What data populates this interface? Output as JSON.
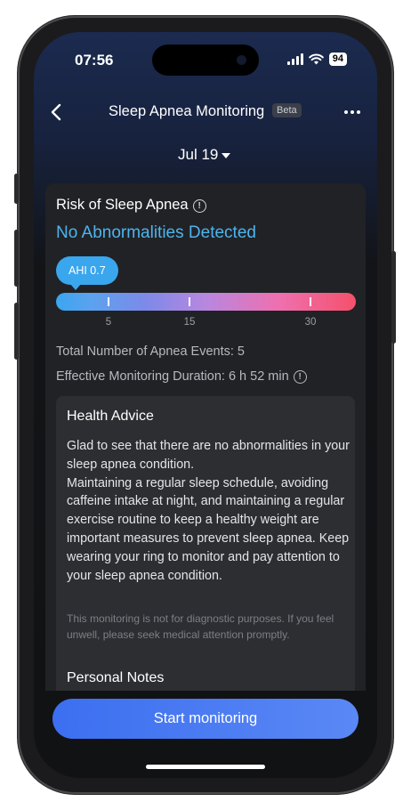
{
  "status_bar": {
    "time": "07:56",
    "battery": "94"
  },
  "nav": {
    "title": "Sleep Apnea Monitoring",
    "badge": "Beta"
  },
  "date_selector": {
    "label": "Jul 19"
  },
  "risk": {
    "title": "Risk of Sleep Apnea",
    "result": "No Abnormalities Detected",
    "ahi_label": "AHI 0.7",
    "ahi_value": 0.7,
    "scale_ticks": [
      "5",
      "15",
      "30"
    ]
  },
  "stats": {
    "events": "Total Number of Apnea Events: 5",
    "duration": "Effective Monitoring Duration: 6 h 52 min"
  },
  "advice": {
    "title": "Health Advice",
    "body": "Glad to see that there are no abnormalities in your sleep apnea condition.\nMaintaining a regular sleep schedule, avoiding caffeine intake at night, and maintaining a regular exercise routine to keep a healthy weight are important measures to prevent sleep apnea. Keep wearing your ring to monitor and pay attention to your sleep apnea condition.",
    "disclaimer": "This monitoring is not for diagnostic purposes. If you feel unwell, please seek medical attention promptly.",
    "notes_title": "Personal Notes"
  },
  "cta": {
    "label": "Start monitoring"
  },
  "colors": {
    "accent": "#4db4ee",
    "button": "#4a7cf2",
    "card": "#212226"
  },
  "icons": [
    "back-chevron-icon",
    "more-dots-icon",
    "info-icon",
    "dropdown-caret-icon",
    "signal-icon",
    "wifi-icon"
  ]
}
